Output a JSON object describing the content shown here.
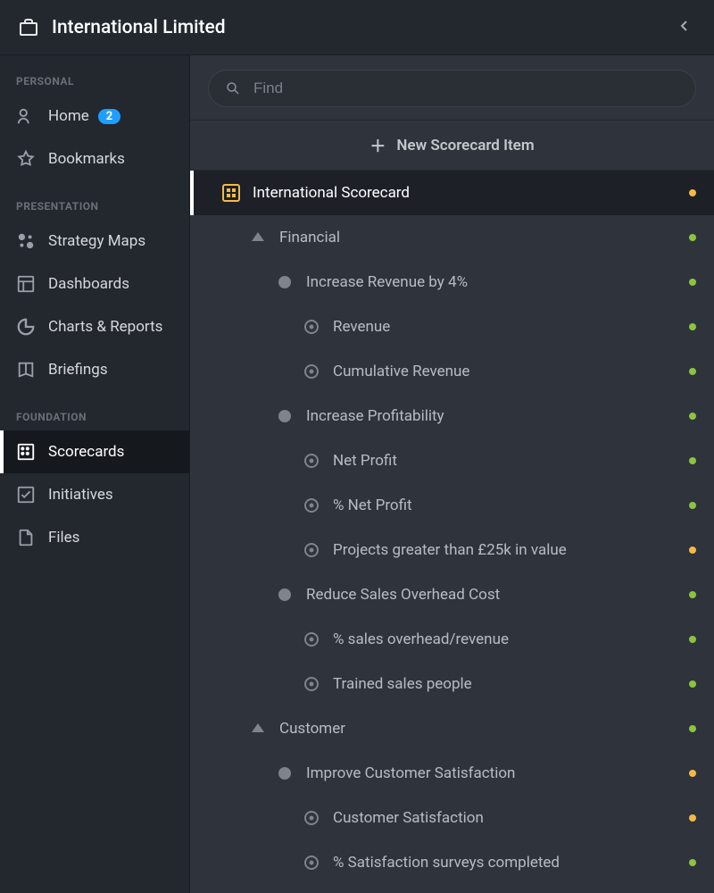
{
  "header": {
    "org_name": "International Limited"
  },
  "sidebar": {
    "sections": [
      {
        "label": "PERSONAL",
        "items": [
          {
            "key": "home",
            "label": "Home",
            "badge": "2"
          },
          {
            "key": "bookmarks",
            "label": "Bookmarks"
          }
        ]
      },
      {
        "label": "PRESENTATION",
        "items": [
          {
            "key": "strategy-maps",
            "label": "Strategy Maps"
          },
          {
            "key": "dashboards",
            "label": "Dashboards"
          },
          {
            "key": "charts-reports",
            "label": "Charts & Reports"
          },
          {
            "key": "briefings",
            "label": "Briefings"
          }
        ]
      },
      {
        "label": "FOUNDATION",
        "items": [
          {
            "key": "scorecards",
            "label": "Scorecards",
            "active": true
          },
          {
            "key": "initiatives",
            "label": "Initiatives"
          },
          {
            "key": "files",
            "label": "Files"
          }
        ]
      }
    ]
  },
  "main": {
    "search_placeholder": "Find",
    "new_button_label": "New Scorecard Item",
    "tree": [
      {
        "level": 0,
        "type": "scorecard",
        "label": "International Scorecard",
        "status": "amber",
        "selected": true
      },
      {
        "level": 1,
        "type": "perspective",
        "label": "Financial",
        "status": "green"
      },
      {
        "level": 2,
        "type": "objective",
        "label": "Increase Revenue by 4%",
        "status": "green"
      },
      {
        "level": 3,
        "type": "measure",
        "label": "Revenue",
        "status": "green"
      },
      {
        "level": 3,
        "type": "measure",
        "label": "Cumulative Revenue",
        "status": "green"
      },
      {
        "level": 2,
        "type": "objective",
        "label": "Increase Profitability",
        "status": "green"
      },
      {
        "level": 3,
        "type": "measure",
        "label": "Net Profit",
        "status": "green"
      },
      {
        "level": 3,
        "type": "measure",
        "label": "% Net Profit",
        "status": "green"
      },
      {
        "level": 3,
        "type": "measure",
        "label": "Projects greater than £25k in value",
        "status": "amber"
      },
      {
        "level": 2,
        "type": "objective",
        "label": "Reduce Sales Overhead Cost",
        "status": "green"
      },
      {
        "level": 3,
        "type": "measure",
        "label": "% sales overhead/revenue",
        "status": "green"
      },
      {
        "level": 3,
        "type": "measure",
        "label": "Trained sales people",
        "status": "green"
      },
      {
        "level": 1,
        "type": "perspective",
        "label": "Customer",
        "status": "green"
      },
      {
        "level": 2,
        "type": "objective",
        "label": "Improve Customer Satisfaction",
        "status": "amber"
      },
      {
        "level": 3,
        "type": "measure",
        "label": "Customer Satisfaction",
        "status": "amber"
      },
      {
        "level": 3,
        "type": "measure",
        "label": "% Satisfaction surveys completed",
        "status": "green"
      }
    ]
  }
}
